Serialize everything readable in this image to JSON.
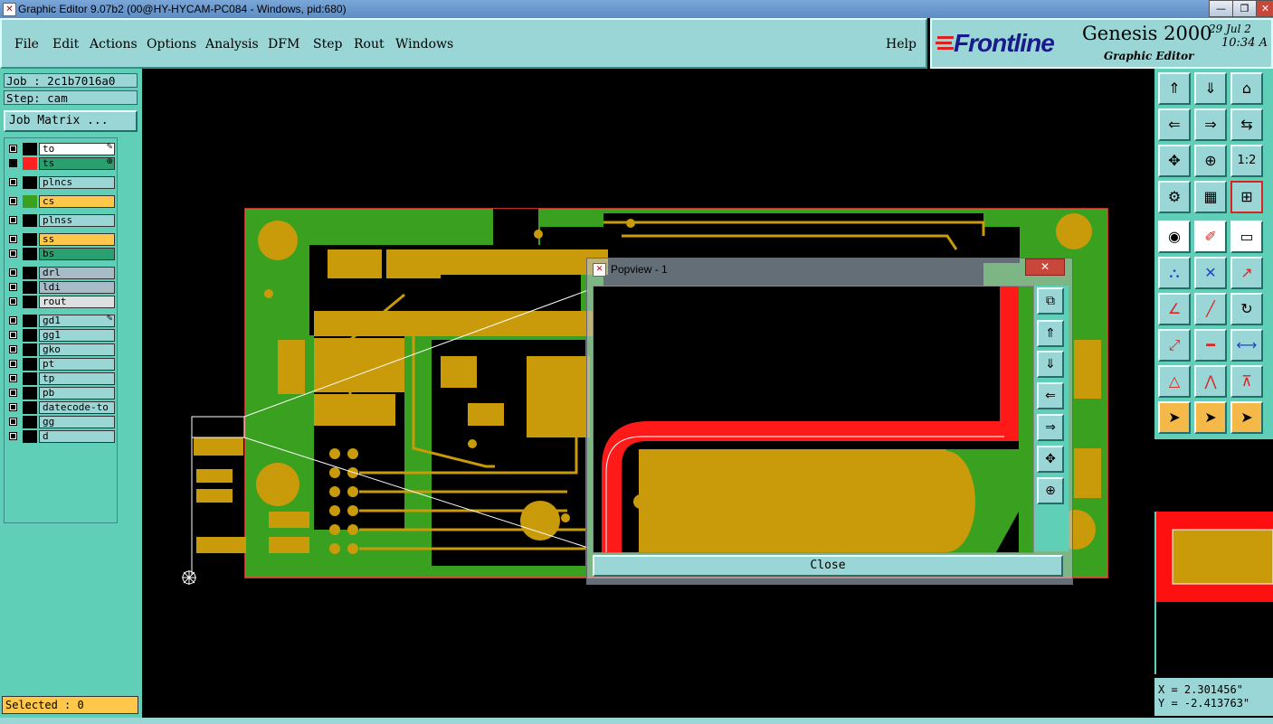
{
  "window": {
    "title": "Graphic Editor 9.07b2 (00@HY-HYCAM-PC084 - Windows, pid:680)",
    "minimize": "—",
    "maximize": "❐",
    "close": "✕"
  },
  "menubar": {
    "items": [
      "File",
      "Edit",
      "Actions",
      "Options",
      "Analysis",
      "DFM",
      "Step",
      "Rout",
      "Windows"
    ],
    "help": "Help"
  },
  "branding": {
    "logo": "Frontline",
    "product": "Genesis 2000",
    "subtitle": "Graphic Editor",
    "date": "29 Jul 2",
    "time": "10:34 A"
  },
  "job": {
    "job_label": "Job : 2c1b7016a0",
    "step_label": "Step: cam",
    "matrix_button": "Job Matrix ..."
  },
  "layers": [
    {
      "name": "to",
      "color": "#ffffff",
      "swatch": "#000000",
      "mark": "✎"
    },
    {
      "name": "ts",
      "color": "#2aa070",
      "swatch": "#ff2020",
      "mark": "⊕",
      "checked_color": "#0000aa"
    },
    {
      "name": "plncs",
      "color": "#9ad6d6",
      "swatch": "#000000"
    },
    {
      "name": "cs",
      "color": "#ffc84a",
      "swatch": "#3aa020"
    },
    {
      "name": "plnss",
      "color": "#9ad6d6",
      "swatch": "#000000"
    },
    {
      "name": "ss",
      "color": "#ffc84a",
      "swatch": "#000000"
    },
    {
      "name": "bs",
      "color": "#2aa070",
      "swatch": "#000000"
    },
    {
      "name": "drl",
      "color": "#a8bcc8",
      "swatch": "#000000"
    },
    {
      "name": "ldi",
      "color": "#a8bcc8",
      "swatch": "#000000"
    },
    {
      "name": "rout",
      "color": "#dde0e0",
      "swatch": "#000000"
    },
    {
      "name": "gd1",
      "color": "#9ad6d6",
      "swatch": "#000000",
      "mark": "✎"
    },
    {
      "name": "gg1",
      "color": "#9ad6d6",
      "swatch": "#000000"
    },
    {
      "name": "gko",
      "color": "#9ad6d6",
      "swatch": "#000000"
    },
    {
      "name": "pt",
      "color": "#9ad6d6",
      "swatch": "#000000"
    },
    {
      "name": "tp",
      "color": "#9ad6d6",
      "swatch": "#000000"
    },
    {
      "name": "pb",
      "color": "#9ad6d6",
      "swatch": "#000000"
    },
    {
      "name": "datecode-to",
      "color": "#9ad6d6",
      "swatch": "#000000"
    },
    {
      "name": "gg",
      "color": "#9ad6d6",
      "swatch": "#000000"
    },
    {
      "name": "d",
      "color": "#9ad6d6",
      "swatch": "#000000"
    }
  ],
  "status": {
    "selected": "Selected : 0",
    "x": "X = 2.301456\"",
    "y": "Y = -2.413763\""
  },
  "toolbar": {
    "zoom_ratio": "1:2"
  },
  "popup": {
    "title": "Popview - 1",
    "close_button": "Close",
    "close_x": "✕"
  }
}
